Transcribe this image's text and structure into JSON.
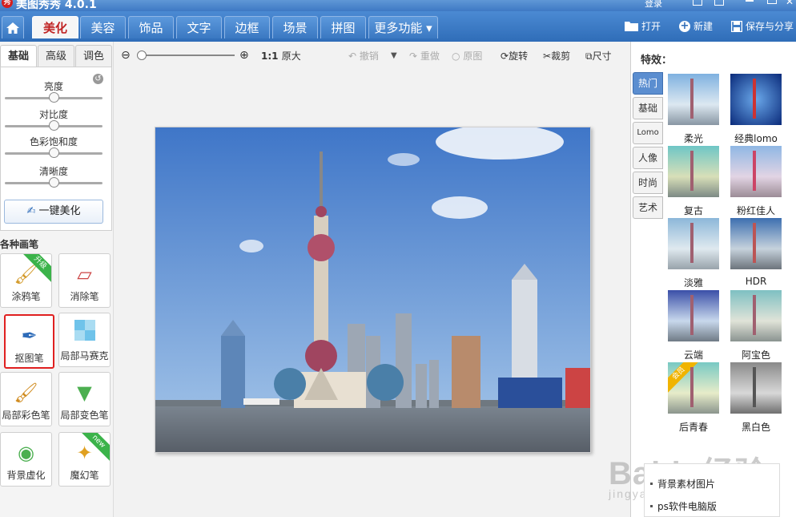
{
  "window": {
    "title": "美图秀秀 4.0.1",
    "login": "登录"
  },
  "nav": {
    "tabs": [
      {
        "label": "美化"
      },
      {
        "label": "美容"
      },
      {
        "label": "饰品"
      },
      {
        "label": "文字"
      },
      {
        "label": "边框"
      },
      {
        "label": "场景"
      },
      {
        "label": "拼图"
      },
      {
        "label": "更多功能 ▾"
      }
    ],
    "open": "打开",
    "new": "新建",
    "save_share": "保存与分享"
  },
  "left": {
    "subtabs": [
      "基础",
      "高级",
      "调色"
    ],
    "sliders": [
      {
        "label": "亮度",
        "value": 0.5
      },
      {
        "label": "对比度",
        "value": 0.5
      },
      {
        "label": "色彩饱和度",
        "value": 0.5
      },
      {
        "label": "清晰度",
        "value": 0.5
      }
    ],
    "one_key": "一键美化",
    "brush_title": "各种画笔",
    "tools": [
      {
        "label": "涂鸦笔",
        "badge": "升级"
      },
      {
        "label": "消除笔"
      },
      {
        "label": "抠图笔"
      },
      {
        "label": "局部马赛克"
      },
      {
        "label": "局部彩色笔"
      },
      {
        "label": "局部变色笔"
      },
      {
        "label": "背景虚化"
      },
      {
        "label": "魔幻笔",
        "badge": "new"
      }
    ]
  },
  "toolbar": {
    "zoom_ratio": "1:1",
    "original_size": "原大",
    "undo": "撤销",
    "redo": "重做",
    "original": "原图",
    "rotate": "旋转",
    "crop": "裁剪",
    "size": "尺寸"
  },
  "right": {
    "title": "特效：",
    "categories": [
      "热门",
      "基础",
      "Lomo",
      "人像",
      "时尚",
      "艺术"
    ],
    "effects": [
      {
        "label": "柔光"
      },
      {
        "label": "经典lomo"
      },
      {
        "label": "复古"
      },
      {
        "label": "粉红佳人"
      },
      {
        "label": "淡雅"
      },
      {
        "label": "HDR"
      },
      {
        "label": "云端"
      },
      {
        "label": "阿宝色"
      },
      {
        "label": "后青春",
        "badge": "会员"
      },
      {
        "label": "黑白色"
      }
    ]
  },
  "popup": {
    "items": [
      "背景素材图片",
      "ps软件电脑版"
    ]
  },
  "watermark": {
    "text": "Baidu经验",
    "sub": "jingyan.baidu.com"
  },
  "colors": {
    "nav_blue": "#3a78c2",
    "active_tab_text": "#c02424",
    "sel_border": "#e02020"
  }
}
